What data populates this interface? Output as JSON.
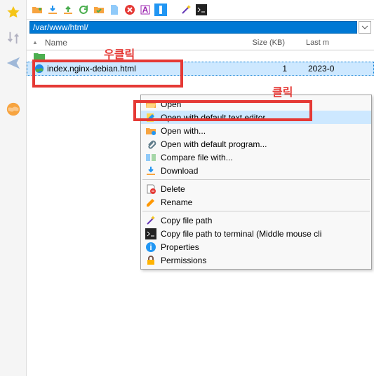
{
  "sidebar": {
    "items": [
      "star",
      "arrows",
      "send",
      "globe"
    ]
  },
  "toolbar": {
    "path": "/var/www/html/"
  },
  "columns": {
    "name": "Name",
    "size": "Size (KB)",
    "last": "Last m"
  },
  "annotations": {
    "right_click": "우클릭",
    "click": "클릭"
  },
  "files": {
    "dotdot_icon": "folder-up",
    "rows": [
      {
        "name": "index.nginx-debian.html",
        "size": "1",
        "last": "2023-0"
      }
    ]
  },
  "context_menu": {
    "items": [
      {
        "label": "Open",
        "icon": "folder-open"
      },
      {
        "label": "Open with default text editor",
        "icon": "edit",
        "highlight": true
      },
      {
        "label": "Open with...",
        "icon": "folder-blue"
      },
      {
        "label": "Open with default program...",
        "icon": "attach"
      },
      {
        "label": "Compare file with...",
        "icon": "compare"
      },
      {
        "label": "Download",
        "icon": "download"
      }
    ],
    "items2": [
      {
        "label": "Delete",
        "icon": "delete"
      },
      {
        "label": "Rename",
        "icon": "rename"
      }
    ],
    "items3": [
      {
        "label": "Copy file path",
        "icon": "wand"
      },
      {
        "label": "Copy file path to terminal (Middle mouse cli",
        "icon": "terminal"
      },
      {
        "label": "Properties",
        "icon": "info"
      },
      {
        "label": "Permissions",
        "icon": "lock"
      }
    ]
  }
}
